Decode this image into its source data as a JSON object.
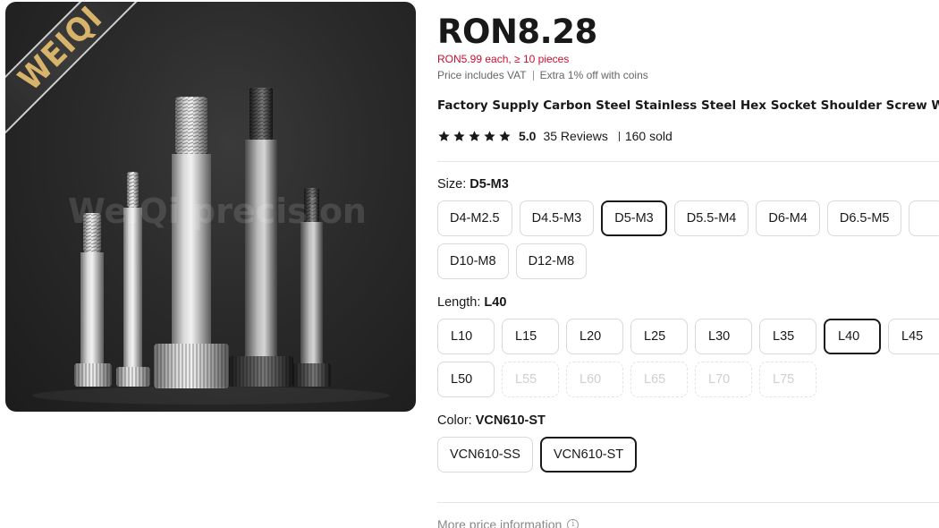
{
  "gallery": {
    "brand_ribbon": "WEIQI",
    "watermark": "WeiQi precision"
  },
  "price": {
    "main": "RON8.28",
    "bulk": "RON5.99 each, ≥ 10 pieces",
    "vat_note": "Price includes VAT",
    "coins_note": "Extra 1% off with coins"
  },
  "product": {
    "title": "Factory Supply Carbon Steel Stainless Steel Hex Socket Shoulder Screw With Co"
  },
  "rating": {
    "score": "5.0",
    "stars": 5,
    "reviews": "35 Reviews",
    "sold": "160 sold",
    "star_color": "#191919"
  },
  "size": {
    "label": "Size:",
    "selected": "D5-M3",
    "options": [
      "D4-M2.5",
      "D4.5-M3",
      "D5-M3",
      "D5.5-M4",
      "D6-M4",
      "D6.5-M5",
      "",
      "D10-M8",
      "D12-M8"
    ]
  },
  "length": {
    "label": "Length:",
    "selected": "L40",
    "options": [
      "L10",
      "L15",
      "L20",
      "L25",
      "L30",
      "L35",
      "L40",
      "L45",
      "L50",
      "L55",
      "L60",
      "L65",
      "L70",
      "L75"
    ]
  },
  "color": {
    "label": "Color:",
    "selected": "VCN610-ST",
    "options": [
      "VCN610-SS",
      "VCN610-ST"
    ]
  },
  "more_info": "More price information",
  "colors": {
    "accent_red": "#c8102e",
    "text": "#191919",
    "border": "#d9d9d9",
    "ribbon_gold": "#d8b46a"
  }
}
